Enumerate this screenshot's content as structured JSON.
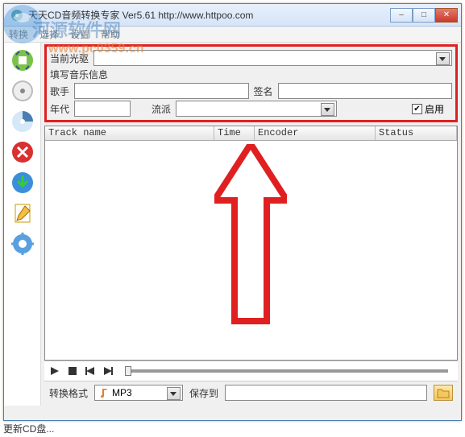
{
  "watermark": {
    "text": "河源软件网",
    "url": "www.pc0359.cn"
  },
  "window": {
    "title": "天天CD音频转换专家 Ver5.61    http://www.httpoo.com",
    "buttons": {
      "min": "–",
      "max": "□",
      "close": "✕"
    }
  },
  "menu": {
    "items": [
      "转换",
      "选择",
      "设置",
      "帮助"
    ]
  },
  "sidebar": {
    "icons": [
      "rip-icon",
      "disc-icon",
      "cd-icon",
      "cancel-icon",
      "download-icon",
      "edit-icon",
      "settings-icon"
    ]
  },
  "top_panel": {
    "drive_label": "当前光驱",
    "drive_value": "",
    "info_label": "填写音乐信息",
    "singer_label": "歌手",
    "singer_value": "",
    "signature_label": "签名",
    "signature_value": "",
    "year_label": "年代",
    "year_value": "",
    "genre_label": "流派",
    "genre_value": "",
    "enable_label": "启用",
    "enable_checked": true
  },
  "table": {
    "columns": [
      "Track name",
      "Time",
      "Encoder",
      "Status"
    ],
    "rows": []
  },
  "playback": {
    "icons": [
      "play",
      "stop",
      "prev",
      "next"
    ]
  },
  "bottom": {
    "format_label": "转换格式",
    "format_value": "MP3",
    "saveto_label": "保存到",
    "saveto_value": ""
  },
  "status": {
    "text": "更新CD盘..."
  },
  "colors": {
    "highlight_red": "#e02020",
    "accent_blue": "#4a7db0"
  }
}
